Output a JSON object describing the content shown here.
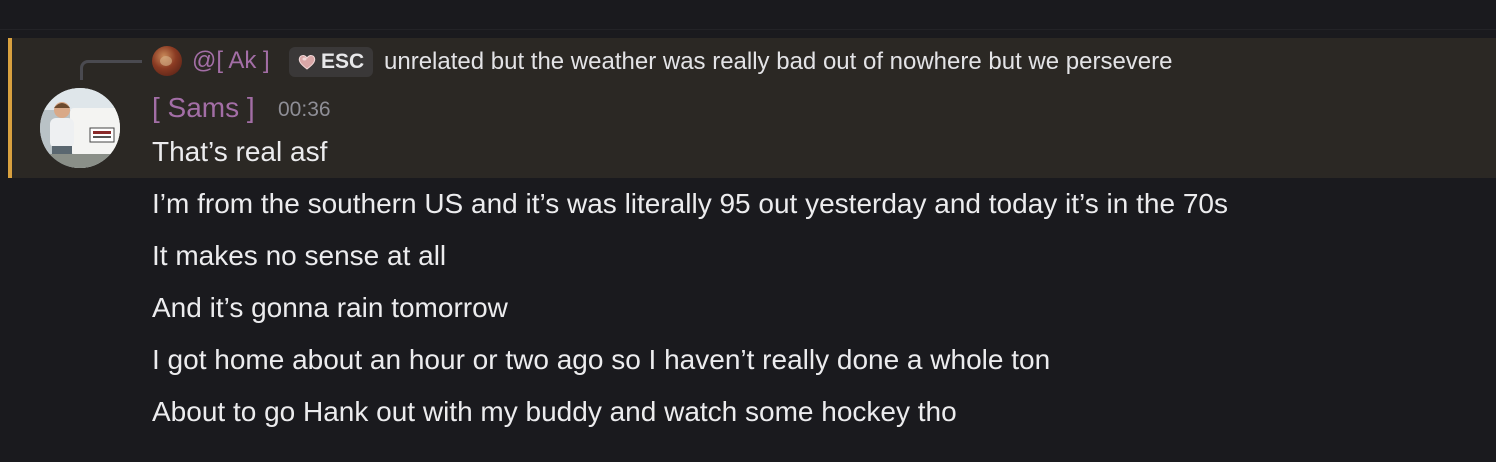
{
  "reply": {
    "author": "@[ Ak ]",
    "tag": "ESC",
    "text": "unrelated but the weather was really bad out of nowhere but we persevere"
  },
  "message": {
    "author": "[ Sams ]",
    "time": "00:36",
    "lines": [
      "That’s real asf",
      "I’m from the southern US and it’s was literally 95 out yesterday and today it’s in the 70s",
      "It makes no sense at all",
      "And it’s gonna rain tomorrow",
      "I got home about an hour or two ago so I haven’t really done a whole ton",
      "About to go Hank out with my buddy and watch some hockey tho"
    ]
  },
  "colors": {
    "background": "#1a1a1e",
    "highlight": "#2b2824",
    "highlight_bar": "#d8a03f",
    "author": "#a36ea6",
    "text": "#ececee",
    "timestamp": "#8e8e96"
  },
  "icons": {
    "reply_avatar": "avatar-icon",
    "tag_icon": "heart-icon"
  }
}
